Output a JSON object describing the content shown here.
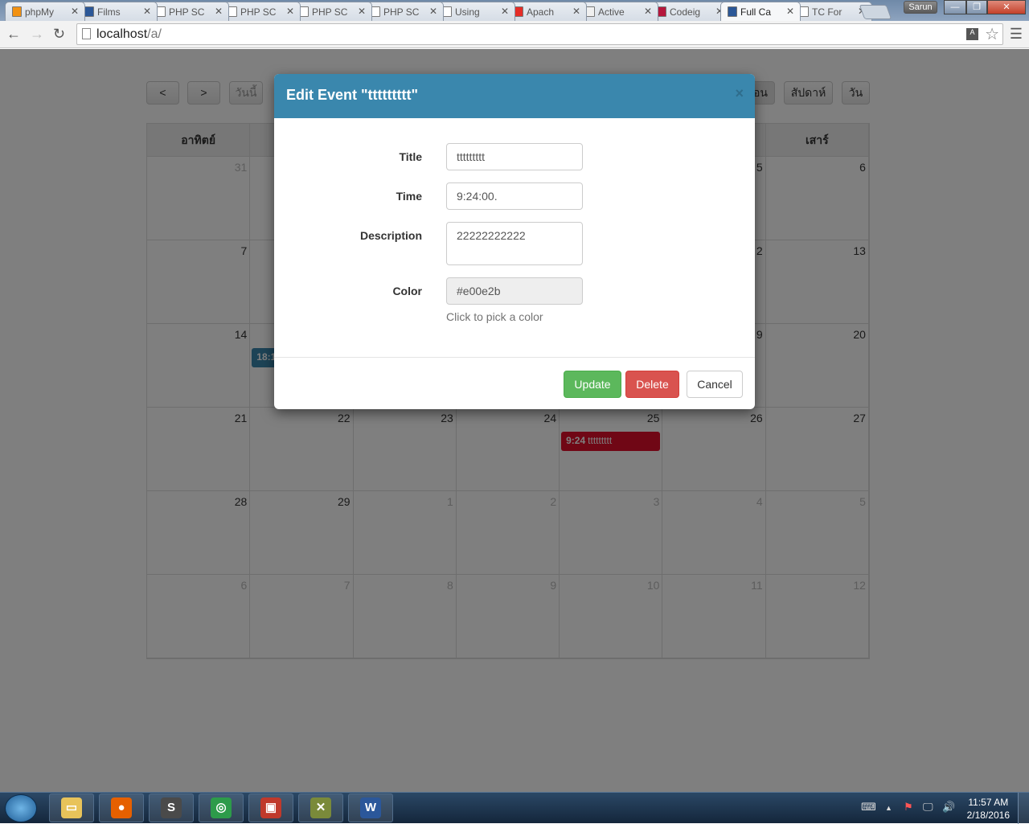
{
  "browser": {
    "tabs": [
      {
        "label": "phpMy",
        "icon": "phpmyadmin-icon",
        "color": "#f29111"
      },
      {
        "label": "Films",
        "icon": "hexagon-logo-icon",
        "color": "#2b5797"
      },
      {
        "label": "PHP SC",
        "icon": "page-icon",
        "color": "#ffffff"
      },
      {
        "label": "PHP SC",
        "icon": "page-icon",
        "color": "#ffffff"
      },
      {
        "label": "PHP SC",
        "icon": "page-icon",
        "color": "#ffffff"
      },
      {
        "label": "PHP SC",
        "icon": "page-icon",
        "color": "#ffffff"
      },
      {
        "label": "Using",
        "icon": "page-icon",
        "color": "#ffffff"
      },
      {
        "label": "Apach",
        "icon": "youtube-icon",
        "color": "#e52d27"
      },
      {
        "label": "Active",
        "icon": "eclipse-icon",
        "color": "#f0f0f0"
      },
      {
        "label": "Codeig",
        "icon": "tp-icon",
        "color": "#b5173c"
      },
      {
        "label": "Full Ca",
        "icon": "hexagon-logo-icon",
        "color": "#2b5797",
        "active": true
      },
      {
        "label": "TC For",
        "icon": "page-icon",
        "color": "#ffffff"
      }
    ],
    "user": "Sarun",
    "url_host": "localhost",
    "url_path": "/a/"
  },
  "calendar": {
    "prev_label": "<",
    "next_label": ">",
    "today_label": "วันนี้",
    "month_label": "อน",
    "week_label": "สัปดาห์",
    "day_label": "วัน",
    "headers": [
      "อาทิตย์",
      "",
      "",
      "",
      "",
      "",
      "เสาร์"
    ],
    "weeks": [
      [
        {
          "d": "31",
          "o": true
        },
        {
          "d": ""
        },
        {
          "d": ""
        },
        {
          "d": ""
        },
        {
          "d": ""
        },
        {
          "d": "5"
        },
        {
          "d": "6"
        }
      ],
      [
        {
          "d": "7"
        },
        {
          "d": ""
        },
        {
          "d": ""
        },
        {
          "d": ""
        },
        {
          "d": ""
        },
        {
          "d": "2"
        },
        {
          "d": "13"
        }
      ],
      [
        {
          "d": "14"
        },
        {
          "d": ""
        },
        {
          "d": ""
        },
        {
          "d": ""
        },
        {
          "d": ""
        },
        {
          "d": "9"
        },
        {
          "d": "20"
        }
      ],
      [
        {
          "d": "21"
        },
        {
          "d": "22"
        },
        {
          "d": "23"
        },
        {
          "d": "24"
        },
        {
          "d": "25"
        },
        {
          "d": "26"
        },
        {
          "d": "27"
        }
      ],
      [
        {
          "d": "28"
        },
        {
          "d": "29"
        },
        {
          "d": "1",
          "o": true
        },
        {
          "d": "2",
          "o": true
        },
        {
          "d": "3",
          "o": true
        },
        {
          "d": "4",
          "o": true
        },
        {
          "d": "5",
          "o": true
        }
      ],
      [
        {
          "d": "6",
          "o": true
        },
        {
          "d": "7",
          "o": true
        },
        {
          "d": "8",
          "o": true
        },
        {
          "d": "9",
          "o": true
        },
        {
          "d": "10",
          "o": true
        },
        {
          "d": "11",
          "o": true
        },
        {
          "d": "12",
          "o": true
        }
      ]
    ],
    "events": [
      {
        "week": 2,
        "day": 1,
        "time": "18:1",
        "title": "",
        "color": "#3a87ad"
      },
      {
        "week": 3,
        "day": 4,
        "time": "9:24",
        "title": "ttttttttt",
        "color": "#e00e2b"
      }
    ]
  },
  "modal": {
    "title": "Edit Event \"ttttttttt\"",
    "close": "×",
    "fields": {
      "title_label": "Title",
      "title_value": "ttttttttt",
      "time_label": "Time",
      "time_value": "9:24:00.",
      "description_label": "Description",
      "description_value": "22222222222",
      "color_label": "Color",
      "color_value": "#e00e2b",
      "color_help": "Click to pick a color"
    },
    "update": "Update",
    "delete": "Delete",
    "cancel": "Cancel"
  },
  "taskbar": {
    "apps": [
      {
        "name": "explorer",
        "color": "#e8c35a",
        "glyph": "▭"
      },
      {
        "name": "firefox",
        "color": "#e66000",
        "glyph": "●"
      },
      {
        "name": "sublime",
        "color": "#4a4a4a",
        "glyph": "S"
      },
      {
        "name": "chrome",
        "color": "#2d9b4a",
        "glyph": "◎"
      },
      {
        "name": "toolbox",
        "color": "#c0392b",
        "glyph": "▣"
      },
      {
        "name": "tools",
        "color": "#7a8a3a",
        "glyph": "✕"
      },
      {
        "name": "word",
        "color": "#2b579a",
        "glyph": "W"
      }
    ],
    "time": "11:57 AM",
    "date": "2/18/2016"
  }
}
